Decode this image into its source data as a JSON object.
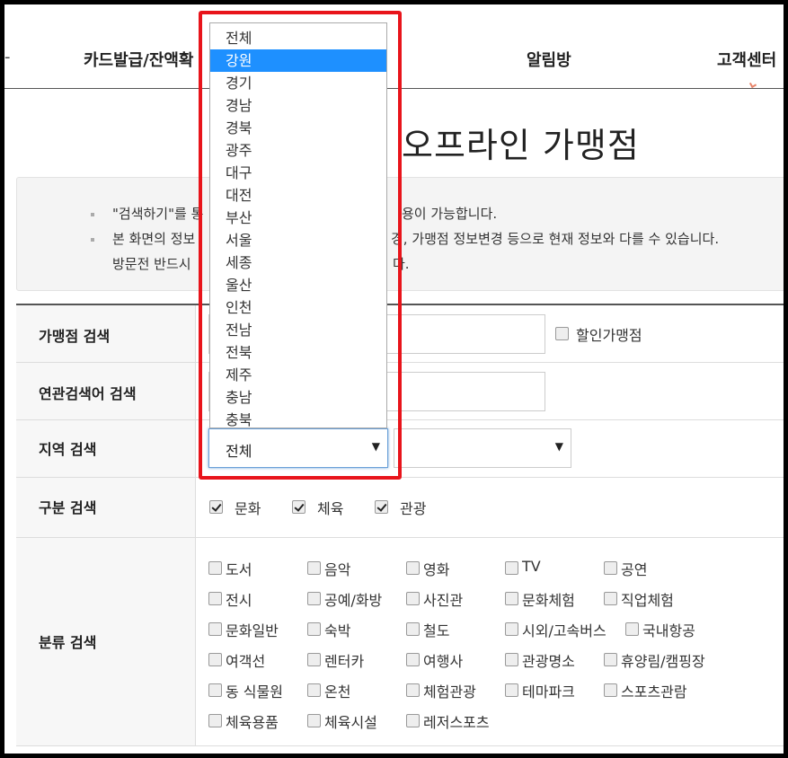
{
  "nav": {
    "dash": "-",
    "items": [
      "카드발급/잔액확",
      "알림방",
      "고객센터"
    ]
  },
  "page_title": "오프라인 가맹점",
  "notice": {
    "line1": "\"검색하기\"를 통",
    "line1_tail": "용이 가능합니다.",
    "line2": "본 화면의 정보",
    "line2_tail": "경, 가맹점 정보변경 등으로 현재 정보와 다를 수 있습니다.",
    "line3": "방문전 반드시",
    "line3_tail": "다."
  },
  "form": {
    "merchant": {
      "label": "가맹점 검색",
      "discount_label": "할인가맹점"
    },
    "related": {
      "label": "연관검색어 검색"
    },
    "region": {
      "label": "지역 검색",
      "selected": "전체",
      "sub_selected": ""
    },
    "type": {
      "label": "구분 검색",
      "options": [
        {
          "label": "문화",
          "checked": true
        },
        {
          "label": "체육",
          "checked": true
        },
        {
          "label": "관광",
          "checked": true
        }
      ]
    },
    "category": {
      "label": "분류 검색",
      "rows": [
        [
          "도서",
          "음악",
          "영화",
          "TV",
          "공연"
        ],
        [
          "전시",
          "공예/화방",
          "사진관",
          "문화체험",
          "직업체험"
        ],
        [
          "문화일반",
          "숙박",
          "철도",
          "시외/고속버스",
          "국내항공"
        ],
        [
          "여객선",
          "렌터카",
          "여행사",
          "관광명소",
          "휴양림/캠핑장"
        ],
        [
          "동 식물원",
          "온천",
          "체험관광",
          "테마파크",
          "스포츠관람"
        ],
        [
          "체육용품",
          "체육시설",
          "레저스포츠"
        ]
      ]
    }
  },
  "dropdown": {
    "selected_index": 1,
    "options": [
      "전체",
      "강원",
      "경기",
      "경남",
      "경북",
      "광주",
      "대구",
      "대전",
      "부산",
      "서울",
      "세종",
      "울산",
      "인천",
      "전남",
      "전북",
      "제주",
      "충남",
      "충북"
    ]
  },
  "colors": {
    "highlight": "#e8141b",
    "selected_option": "#1e90ff"
  }
}
